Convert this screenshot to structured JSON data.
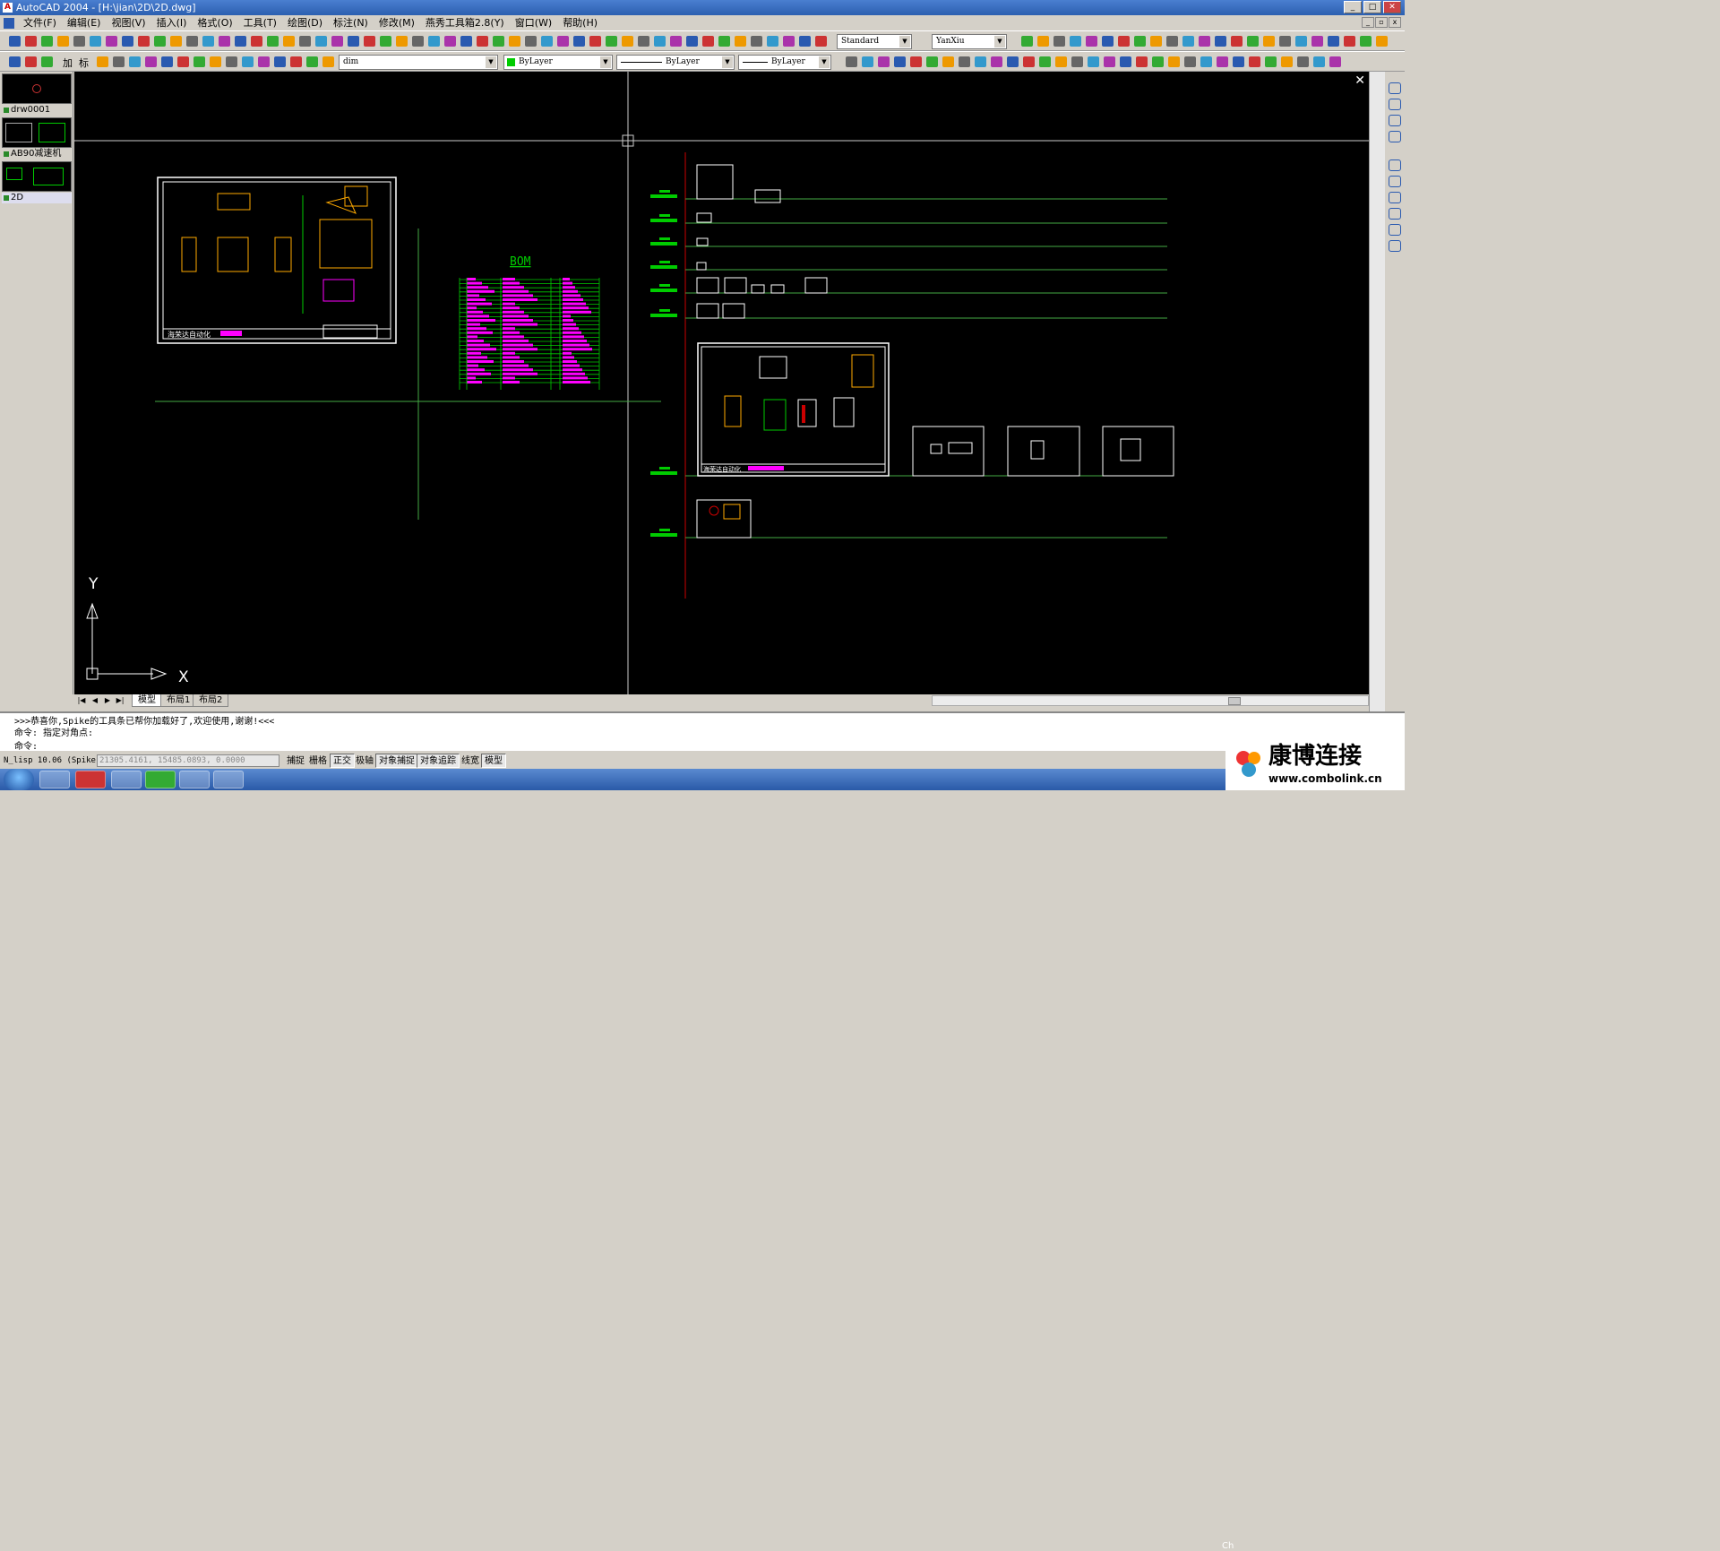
{
  "window": {
    "title": "AutoCAD 2004 - [H:\\jian\\2D\\2D.dwg]"
  },
  "menu": [
    "文件(F)",
    "编辑(E)",
    "视图(V)",
    "插入(I)",
    "格式(O)",
    "工具(T)",
    "绘图(D)",
    "标注(N)",
    "修改(M)",
    "燕秀工具箱2.8(Y)",
    "窗口(W)",
    "帮助(H)"
  ],
  "toolbar": {
    "textstyle": "Standard",
    "dimstyle": "YanXiu",
    "layer": "dim",
    "color": "ByLayer",
    "linetype": "ByLayer",
    "lineweight": "ByLayer",
    "tb2_left_chars": [
      "加",
      "标"
    ]
  },
  "sidebar": {
    "items": [
      {
        "label": "drw0001"
      },
      {
        "label": "AB90减速机"
      },
      {
        "label": "2D"
      }
    ]
  },
  "drawing": {
    "bom_title": "BOM",
    "titleblock_text_1": "海荣达自动化",
    "titleblock_text_2": "海荣达自动化",
    "ucs_y": "Y",
    "ucs_x": "X"
  },
  "tabs": {
    "model": "模型",
    "layout1": "布局1",
    "layout2": "布局2"
  },
  "command": {
    "line1": ">>>恭喜你,Spike的工具条已帮你加载好了,欢迎使用,谢谢!<<<",
    "line2": "命令: 指定对角点:",
    "line3": "命令:"
  },
  "status": {
    "lisp": "N_lisp 10.06 (Spike)",
    "coords": "21305.4161, 15485.0893, 0.0000",
    "buttons": [
      "捕捉",
      "栅格",
      "正交",
      "极轴",
      "对象捕捉",
      "对象追踪",
      "线宽",
      "模型"
    ],
    "on": [
      false,
      false,
      true,
      false,
      true,
      true,
      false,
      true
    ]
  },
  "watermark": {
    "brand": "康博连接",
    "url": "www.combolink.cn"
  },
  "clock": "Ch",
  "colors": {
    "cad_bg": "#000000",
    "green": "#00cc00",
    "magenta": "#ff00ff",
    "orange": "#ffaa00",
    "white": "#ffffff",
    "red": "#cc0000"
  }
}
